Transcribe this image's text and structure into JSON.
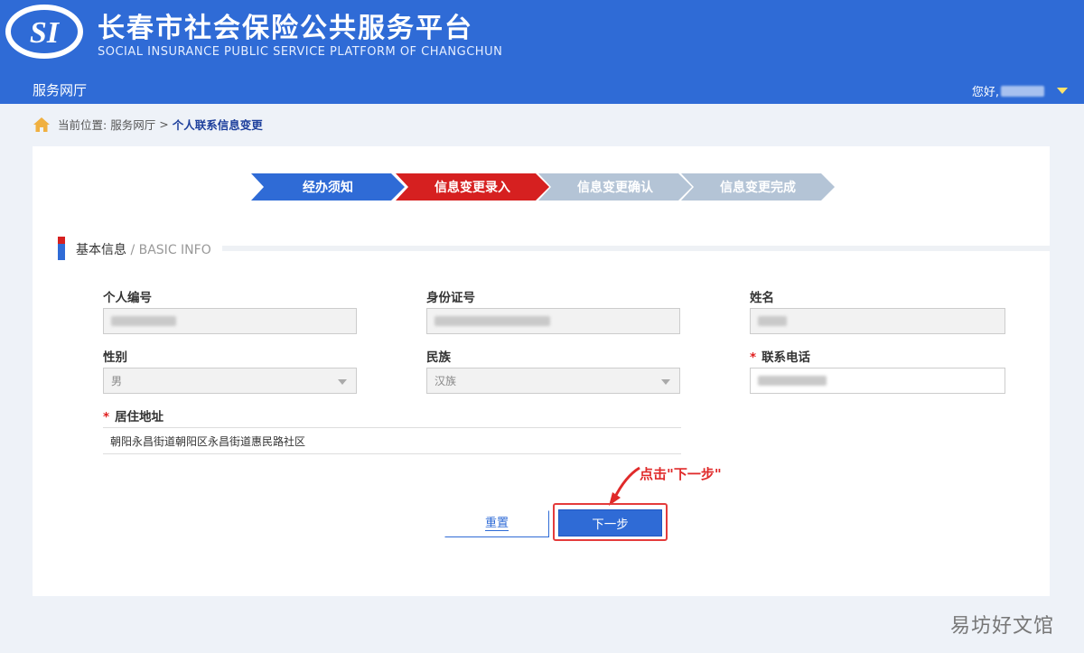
{
  "header": {
    "title": "长春市社会保险公共服务平台",
    "subtitle": "SOCIAL INSURANCE PUBLIC SERVICE PLATFORM OF CHANGCHUN",
    "logo_text": "SI",
    "nav_title": "服务网厅",
    "greeting": "您好,"
  },
  "breadcrumb": {
    "prefix": "当前位置:",
    "parent": "服务网厅",
    "separator": ">",
    "current": "个人联系信息变更"
  },
  "steps": [
    {
      "label": "经办须知",
      "state": "done",
      "color": "#2f6bd6"
    },
    {
      "label": "信息变更录入",
      "state": "active",
      "color": "#d62020"
    },
    {
      "label": "信息变更确认",
      "state": "pending",
      "color": "#b4c4d6"
    },
    {
      "label": "信息变更完成",
      "state": "pending",
      "color": "#b4c4d6"
    }
  ],
  "section": {
    "title": "基本信息",
    "title_en": " / BASIC INFO"
  },
  "form": {
    "personal_no_label": "个人编号",
    "id_no_label": "身份证号",
    "name_label": "姓名",
    "gender_label": "性别",
    "gender_value": "男",
    "ethnicity_label": "民族",
    "ethnicity_value": "汉族",
    "phone_label": "联系电话",
    "address_label": "居住地址",
    "address_value": "朝阳永昌街道朝阳区永昌街道惠民路社区",
    "required_mark": "*"
  },
  "buttons": {
    "reset": "重置",
    "next": "下一步"
  },
  "annotation": "点击\"下一步\"",
  "watermark": "易坊好文馆",
  "colors": {
    "brand_blue": "#2f6bd6",
    "active_red": "#d62020",
    "pending_gray": "#b4c4d6",
    "highlight_red": "#e43b3b"
  }
}
